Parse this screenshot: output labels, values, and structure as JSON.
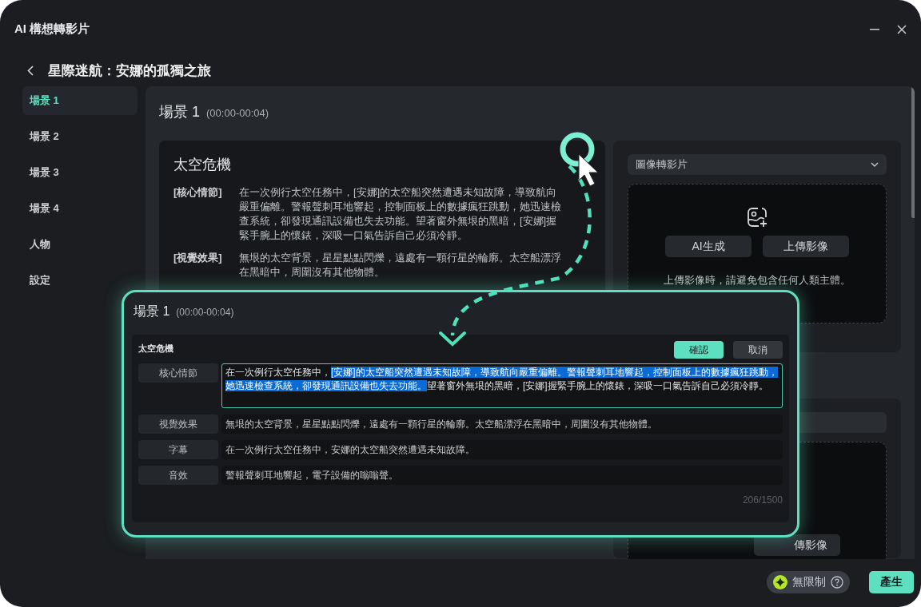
{
  "window": {
    "title": "AI 構想轉影片"
  },
  "header": {
    "title": "星際迷航：安娜的孤獨之旅"
  },
  "sidebar": {
    "items": [
      {
        "label": "場景 1",
        "selected": true
      },
      {
        "label": "場景 2",
        "selected": false
      },
      {
        "label": "場景 3",
        "selected": false
      },
      {
        "label": "場景 4",
        "selected": false
      },
      {
        "label": "人物",
        "selected": false
      },
      {
        "label": "設定",
        "selected": false
      }
    ]
  },
  "scene": {
    "title": "場景 1",
    "time": "(00:00-00:04)",
    "card": {
      "title": "太空危機",
      "rows": [
        {
          "label": "[核心情節]",
          "text": "在一次例行太空任務中，[安娜]的太空船突然遭遇未知故障，導致航向嚴重偏離。警報聲刺耳地響起，控制面板上的數據瘋狂跳動，她迅速檢查系統，卻發現通訊設備也失去功能。望著窗外無垠的黑暗，[安娜]握緊手腕上的懷錶，深吸一口氣告訴自己必須冷靜。"
        },
        {
          "label": "[視覺效果]",
          "text": "無垠的太空背景，星星點點閃爍，遠處有一顆行星的輪廓。太空船漂浮在黑暗中，周圍沒有其他物體。"
        }
      ]
    },
    "media": {
      "mode": "圖像轉影片",
      "buttons": [
        "AI生成",
        "上傳影像"
      ],
      "hint": "上傳影像時，請避免包含任何人類主體。"
    }
  },
  "next_scene": {
    "media": {
      "button": "傳影像"
    }
  },
  "editor": {
    "title": "場景 1",
    "time": "(00:00-00:04)",
    "card_title": "太空危機",
    "confirm": "確認",
    "cancel": "取消",
    "fields": [
      {
        "label": "核心情節",
        "kind": "textarea",
        "before": "在一次例行太空任務中，",
        "selected": "[安娜]的太空船突然遭遇未知故障，導致航向嚴重偏離。警報聲刺耳地響起，控制面板上的數據瘋狂跳動，她迅速檢查系統，卻發現通訊設備也失去功能。",
        "after": "望著窗外無垠的黑暗，[安娜]握緊手腕上的懷錶，深吸一口氣告訴自己必須冷靜。"
      },
      {
        "label": "視覺效果",
        "kind": "text",
        "text": "無垠的太空背景，星星點點閃爍，遠處有一顆行星的輪廓。太空船漂浮在黑暗中，周圍沒有其他物體。"
      },
      {
        "label": "字幕",
        "kind": "text",
        "text": "在一次例行太空任務中，安娜的太空船突然遭遇未知故障。"
      },
      {
        "label": "音效",
        "kind": "text",
        "text": "警報聲刺耳地響起，電子設備的嗡嗡聲。"
      }
    ],
    "counter": "206/1500"
  },
  "footer": {
    "plan": "無限制",
    "generate": "產生"
  }
}
